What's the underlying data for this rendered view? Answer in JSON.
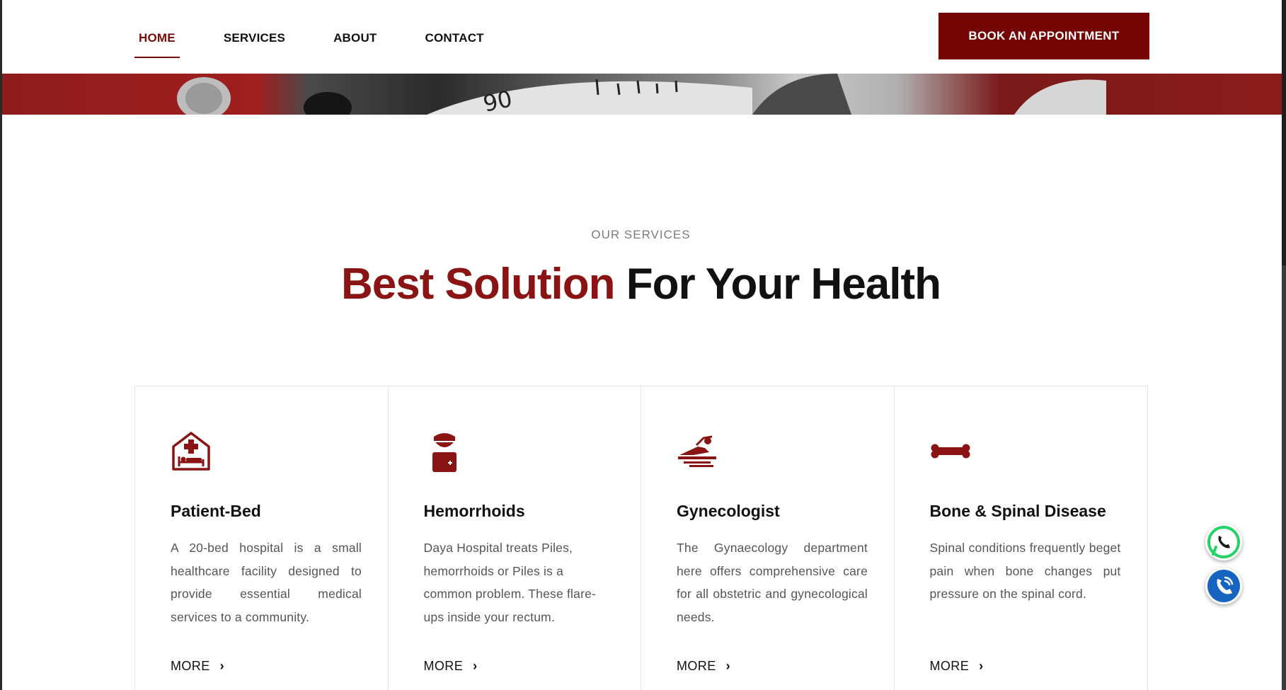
{
  "nav": {
    "items": [
      {
        "label": "HOME",
        "active": true
      },
      {
        "label": "SERVICES",
        "active": false
      },
      {
        "label": "ABOUT",
        "active": false
      },
      {
        "label": "CONTACT",
        "active": false
      }
    ],
    "cta_label": "BOOK AN APPOINTMENT"
  },
  "hero": {
    "dial_number": "90"
  },
  "section": {
    "label": "OUR SERVICES",
    "title_accent": "Best Solution",
    "title_rest": " For Your Health"
  },
  "services": [
    {
      "icon": "hospital-bed-icon",
      "title": "Patient-Bed",
      "description": "A 20-bed hospital is a small healthcare facility designed to provide essential medical services to a community.",
      "more_label": "MORE"
    },
    {
      "icon": "doctor-icon",
      "title": "Hemorrhoids",
      "description": "Daya Hospital treats Piles, hemorrhoids or Piles is a common problem. These flare-ups inside your rectum.",
      "more_label": "MORE"
    },
    {
      "icon": "patient-stretcher-icon",
      "title": "Gynecologist",
      "description": "The Gynaecology department here offers comprehensive care for all obstetric and gynecological needs.",
      "more_label": "MORE"
    },
    {
      "icon": "bone-icon",
      "title": "Bone & Spinal Disease",
      "description": "Spinal conditions frequently beget pain when bone changes put pressure on the spinal cord.",
      "more_label": "MORE"
    }
  ],
  "floating": {
    "whatsapp_icon": "whatsapp-icon",
    "phone_icon": "phone-icon"
  },
  "colors": {
    "brand": "#750404",
    "accent_text": "#8a1414",
    "whatsapp": "#25D366",
    "phone": "#1565c0"
  }
}
